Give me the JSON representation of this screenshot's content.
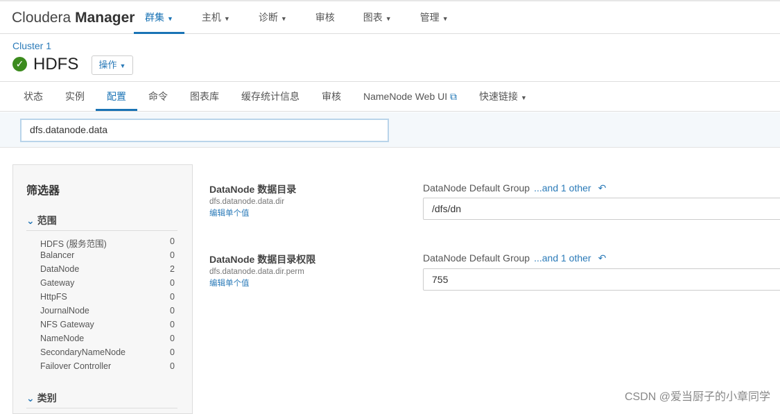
{
  "app": {
    "logo_light": "Cloudera",
    "logo_bold": "Manager"
  },
  "nav": [
    {
      "label": "群集",
      "caret": true
    },
    {
      "label": "主机",
      "caret": true
    },
    {
      "label": "诊断",
      "caret": true
    },
    {
      "label": "审核",
      "caret": false
    },
    {
      "label": "图表",
      "caret": true
    },
    {
      "label": "管理",
      "caret": true
    }
  ],
  "breadcrumb": "Cluster 1",
  "service": {
    "title": "HDFS",
    "status": "ok",
    "actions_label": "操作"
  },
  "tabs": [
    "状态",
    "实例",
    "配置",
    "命令",
    "图表库",
    "缓存统计信息",
    "审核",
    "NameNode Web UI",
    "快速链接"
  ],
  "search": {
    "value": "dfs.datanode.data"
  },
  "filter": {
    "title": "筛选器",
    "scope_label": "范围",
    "category_label": "类别",
    "items": [
      {
        "name": "HDFS (服务范围)",
        "count": "0"
      },
      {
        "name": "Balancer",
        "count": "0"
      },
      {
        "name": "DataNode",
        "count": "2"
      },
      {
        "name": "Gateway",
        "count": "0"
      },
      {
        "name": "HttpFS",
        "count": "0"
      },
      {
        "name": "JournalNode",
        "count": "0"
      },
      {
        "name": "NFS Gateway",
        "count": "0"
      },
      {
        "name": "NameNode",
        "count": "0"
      },
      {
        "name": "SecondaryNameNode",
        "count": "0"
      },
      {
        "name": "Failover Controller",
        "count": "0"
      }
    ]
  },
  "configs": [
    {
      "name": "DataNode 数据目录",
      "key": "dfs.datanode.data.dir",
      "edit": "编辑单个值",
      "group": "DataNode Default Group",
      "other": "...and 1 other",
      "value": "/dfs/dn"
    },
    {
      "name": "DataNode 数据目录权限",
      "key": "dfs.datanode.data.dir.perm",
      "edit": "编辑单个值",
      "group": "DataNode Default Group",
      "other": "...and 1 other",
      "value": "755"
    }
  ],
  "watermark": "CSDN @爱当厨子的小章同学",
  "colors": {
    "accent": "#1a73b5",
    "ok": "#3c8b1e"
  }
}
